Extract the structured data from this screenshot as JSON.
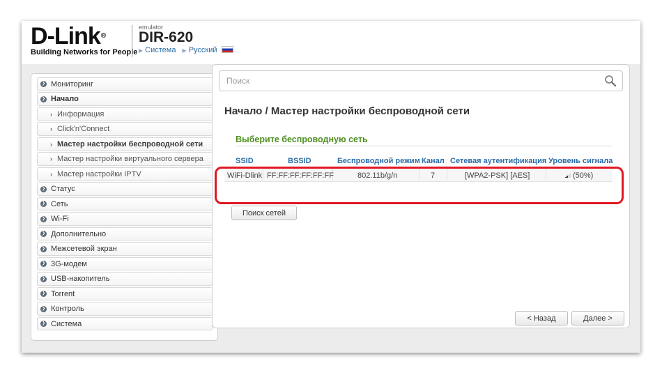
{
  "header": {
    "logo": "D-Link",
    "logo_reg": "®",
    "tagline": "Building Networks for People",
    "emulator_label": "emulator",
    "model": "DIR-620",
    "link_system": "Система",
    "link_language": "Русский"
  },
  "sidebar": {
    "items": [
      {
        "label": "Мониторинг"
      },
      {
        "label": "Начало"
      },
      {
        "label": "Информация"
      },
      {
        "label": "Click'n'Connect"
      },
      {
        "label": "Мастер настройки беспроводной сети"
      },
      {
        "label": "Мастер настройки виртуального сервера"
      },
      {
        "label": "Мастер настройки IPTV"
      },
      {
        "label": "Статус"
      },
      {
        "label": "Сеть"
      },
      {
        "label": "Wi-Fi"
      },
      {
        "label": "Дополнительно"
      },
      {
        "label": "Межсетевой экран"
      },
      {
        "label": "3G-модем"
      },
      {
        "label": "USB-накопитель"
      },
      {
        "label": "Torrent"
      },
      {
        "label": "Контроль"
      },
      {
        "label": "Система"
      }
    ]
  },
  "search": {
    "placeholder": "Поиск"
  },
  "main": {
    "title": "Начало /  Мастер настройки беспроводной сети",
    "section_title": "Выберите беспроводную сеть",
    "columns": [
      "SSID",
      "BSSID",
      "Беспроводной режим",
      "Канал",
      "Сетевая аутентификация",
      "Уровень сигнала"
    ],
    "rows": [
      {
        "ssid": "WiFi-Dlink",
        "bssid": "FF:FF:FF:FF:FF:FF",
        "mode": "802.11b/g/n",
        "channel": "7",
        "auth": "[WPA2-PSK] [AES]",
        "signal": "(50%)",
        "signal_level": 0.5
      }
    ],
    "scan_button": "Поиск сетей",
    "back_button": "< Назад",
    "next_button": "Далее >"
  },
  "colors": {
    "accent_blue": "#2b6da8",
    "section_green": "#4e8f1f",
    "highlight_red": "#e01822"
  }
}
